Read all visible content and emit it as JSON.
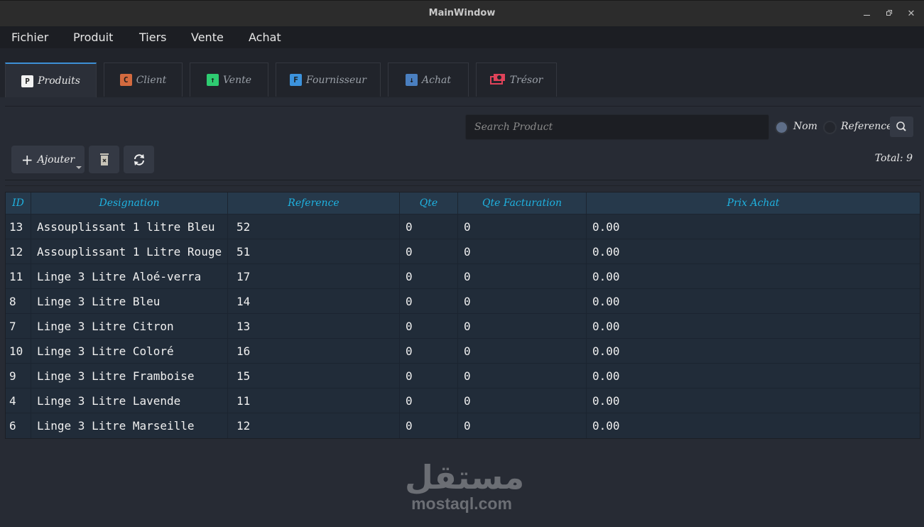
{
  "window": {
    "title": "MainWindow",
    "controls": [
      "minimize-icon",
      "maximize-icon",
      "close-icon"
    ]
  },
  "menubar": {
    "items": [
      "Fichier",
      "Produit",
      "Tiers",
      "Vente",
      "Achat"
    ]
  },
  "tabs": [
    {
      "label": "Produits",
      "icon": "P",
      "icon_color": "#f2f2f2",
      "active": true
    },
    {
      "label": "Client",
      "icon": "C",
      "icon_color": "#d36a3f",
      "active": false
    },
    {
      "label": "Vente",
      "icon": "↑",
      "icon_color": "#2ecc71",
      "active": false
    },
    {
      "label": "Fournisseur",
      "icon": "F",
      "icon_color": "#3c93dd",
      "active": false
    },
    {
      "label": "Achat",
      "icon": "↓",
      "icon_color": "#4a7fc0",
      "active": false
    },
    {
      "label": "Trésor",
      "icon": "money-icon",
      "icon_color": "#e0435a",
      "active": false
    }
  ],
  "search": {
    "placeholder": "Search Product",
    "value": "",
    "radio_options": [
      {
        "label": "Nom",
        "checked": true
      },
      {
        "label": "Reference",
        "checked": false
      }
    ]
  },
  "toolbar": {
    "add_label": "Ajouter",
    "delete_icon": "trash-icon",
    "refresh_icon": "refresh-icon",
    "total_label": "Total: 9"
  },
  "table": {
    "columns": [
      "ID",
      "Designation",
      "Reference",
      "Qte",
      "Qte Facturation",
      "Prix Achat"
    ],
    "rows": [
      [
        "13",
        "Assouplissant 1 litre Bleu",
        "52",
        "0",
        "0",
        "0.00"
      ],
      [
        "12",
        "Assouplissant 1 Litre Rouge",
        "51",
        "0",
        "0",
        "0.00"
      ],
      [
        "11",
        "Linge 3 Litre Aloé-verra",
        "17",
        "0",
        "0",
        "0.00"
      ],
      [
        "8",
        "Linge 3 Litre Bleu",
        "14",
        "0",
        "0",
        "0.00"
      ],
      [
        "7",
        "Linge 3 Litre Citron",
        "13",
        "0",
        "0",
        "0.00"
      ],
      [
        "10",
        "Linge 3 Litre Coloré",
        "16",
        "0",
        "0",
        "0.00"
      ],
      [
        "9",
        "Linge 3 Litre Framboise",
        "15",
        "0",
        "0",
        "0.00"
      ],
      [
        "4",
        "Linge 3 Litre Lavende",
        "11",
        "0",
        "0",
        "0.00"
      ],
      [
        "6",
        "Linge 3 Litre Marseille",
        "12",
        "0",
        "0",
        "0.00"
      ]
    ]
  },
  "watermark": {
    "arabic": "مستقل",
    "latin": "mostaql.com"
  },
  "colors": {
    "accent_tab": "#3d8fd6",
    "header_text": "#1fb2e0",
    "header_bg": "#26394b",
    "row_bg": "#212c39"
  }
}
